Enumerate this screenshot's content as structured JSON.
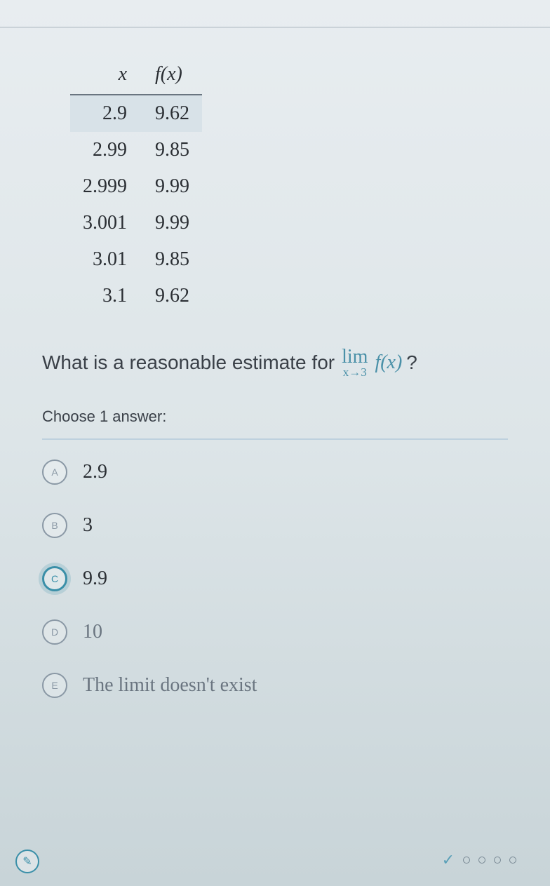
{
  "table": {
    "headers": {
      "x": "x",
      "fx": "f(x)"
    },
    "rows": [
      {
        "x": "2.9",
        "fx": "9.62"
      },
      {
        "x": "2.99",
        "fx": "9.85"
      },
      {
        "x": "2.999",
        "fx": "9.99"
      },
      {
        "x": "3.001",
        "fx": "9.99"
      },
      {
        "x": "3.01",
        "fx": "9.85"
      },
      {
        "x": "3.1",
        "fx": "9.62"
      }
    ]
  },
  "question": {
    "prefix": "What is a reasonable estimate for",
    "lim": "lim",
    "sub": "x→3",
    "fx": "f(x)",
    "suffix": "?"
  },
  "choose_label": "Choose 1 answer:",
  "options": [
    {
      "letter": "A",
      "label": "2.9"
    },
    {
      "letter": "B",
      "label": "3"
    },
    {
      "letter": "C",
      "label": "9.9"
    },
    {
      "letter": "D",
      "label": "10"
    },
    {
      "letter": "E",
      "label": "The limit doesn't exist"
    }
  ],
  "selected_index": 2,
  "nav_icon": "✎"
}
